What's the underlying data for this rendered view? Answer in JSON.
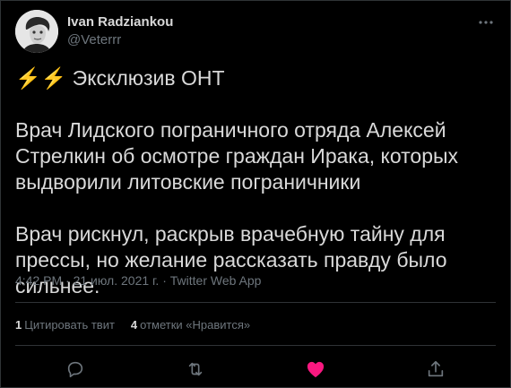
{
  "user": {
    "display_name": "Ivan Radziankou",
    "handle": "@Veterrr"
  },
  "tweet": {
    "headline_emoji": "⚡⚡",
    "headline_text": "Эксклюзив ОНТ",
    "paragraph_1": "Врач Лидского пограничного отряда Алексей Стрелкин об осмотре граждан Ирака, которых выдворили литовские пограничники",
    "paragraph_2": "Врач рискнул, раскрыв врачебную тайну для прессы, но желание рассказать правду было сильнее.",
    "meta": "4:42 PM · 21 июл. 2021 г. · Twitter Web App"
  },
  "stats": {
    "quotes_count": "1",
    "quotes_label": "Цитировать твит",
    "likes_count": "4",
    "likes_label": "отметки «Нравится»"
  },
  "icons": {
    "more": "more-icon",
    "reply": "reply-icon",
    "retweet": "retweet-icon",
    "like": "heart-icon",
    "share": "share-icon"
  },
  "colors": {
    "background": "#000000",
    "text": "#d9d9d9",
    "secondary": "#6e767d",
    "like": "#f91880",
    "bolt": "#f5b400"
  }
}
